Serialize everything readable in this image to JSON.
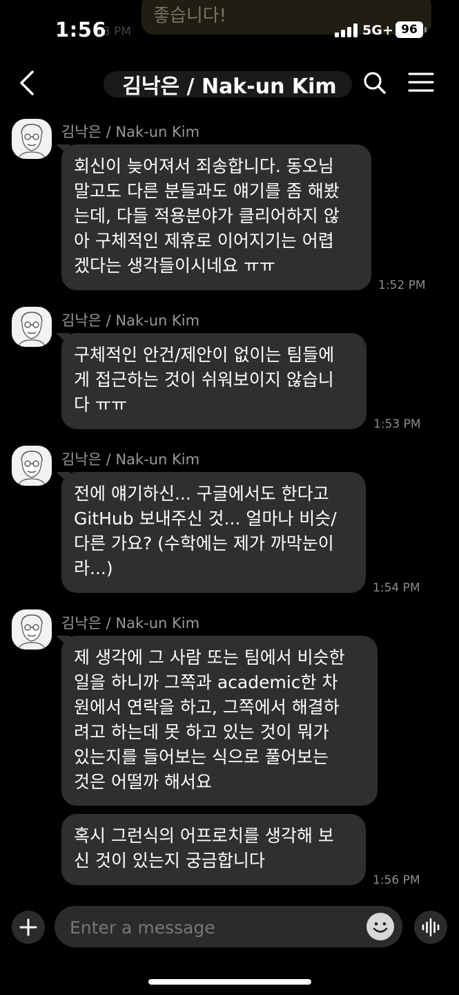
{
  "status_bar": {
    "time": "1:56",
    "network": "5G+",
    "battery": "96"
  },
  "ghost": {
    "text": "좋습니다!",
    "time": "13 PM"
  },
  "header": {
    "title": "김낙은 / Nak-un Kim"
  },
  "contact": {
    "name": "김낙은 / Nak-un Kim"
  },
  "messages": [
    {
      "sender": "김낙은 / Nak-un Kim",
      "text": "회신이 늦어져서 죄송합니다. 동오님\n말고도 다른 분들과도 얘기를 좀 해봤\n는데, 다들 적용분야가 클리어하지 않\n아 구체적인 제휴로 이어지기는 어렵\n겠다는 생각들이시네요 ㅠㅠ",
      "time": "1:52 PM"
    },
    {
      "sender": "김낙은 / Nak-un Kim",
      "text": "구체적인 안건/제안이 없이는 팀들에\n게 접근하는 것이 쉬워보이지 않습니\n다 ㅠㅠ",
      "time": "1:53 PM"
    },
    {
      "sender": "김낙은 / Nak-un Kim",
      "text": "전에 얘기하신... 구글에서도 한다고\nGitHub 보내주신 것... 얼마나 비슷/\n다른 가요? (수학에는 제가 까막눈이\n라...)",
      "time": "1:54 PM"
    },
    {
      "sender": "김낙은 / Nak-un Kim",
      "text": "제 생각에 그 사람 또는 팀에서 비슷한\n일을 하니까 그쪽과 academic한 차\n원에서 연락을 하고, 그쪽에서 해결하\n려고 하는데 못 하고 있는 것이 뭐가\n있는지를 들어보는 식으로 풀어보는\n것은 어떨까 해서요",
      "time": ""
    },
    {
      "sender": "",
      "text": "혹시 그런식의 어프로치를 생각해 보\n신 것이 있는지 궁금합니다",
      "time": "1:56 PM"
    }
  ],
  "composer": {
    "placeholder": "Enter a message"
  },
  "icons": {
    "back": "chevron-left-icon",
    "search": "search-icon",
    "menu": "hamburger-menu-icon",
    "add": "plus-icon",
    "emoji": "smiley-icon",
    "voice": "voice-wave-icon"
  },
  "colors": {
    "background": "#000000",
    "bubble": "#2f2f2f",
    "secondary_text": "#9a9a9a"
  }
}
